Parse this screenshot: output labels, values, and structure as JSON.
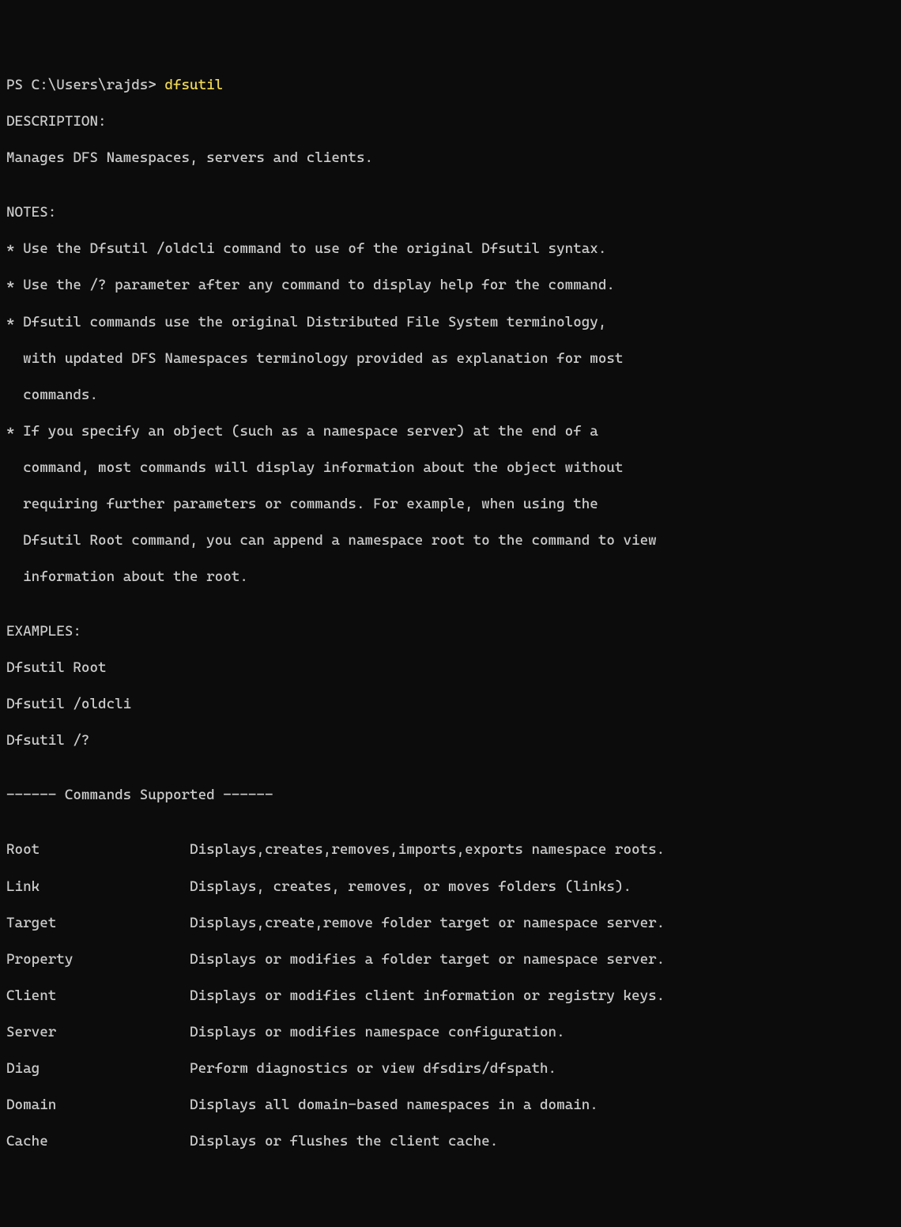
{
  "prompt": "PS C:\\Users\\rajds> ",
  "command": "dfsutil",
  "blank1": "",
  "description_header": "DESCRIPTION:",
  "description_text": "Manages DFS Namespaces, servers and clients.",
  "blank2": "",
  "notes_header": "NOTES:",
  "note1": "* Use the Dfsutil /oldcli command to use of the original Dfsutil syntax.",
  "note2": "* Use the /? parameter after any command to display help for the command.",
  "note3a": "* Dfsutil commands use the original Distributed File System terminology,",
  "note3b": "  with updated DFS Namespaces terminology provided as explanation for most",
  "note3c": "  commands.",
  "note4a": "* If you specify an object (such as a namespace server) at the end of a",
  "note4b": "  command, most commands will display information about the object without",
  "note4c": "  requiring further parameters or commands. For example, when using the",
  "note4d": "  Dfsutil Root command, you can append a namespace root to the command to view",
  "note4e": "  information about the root.",
  "blank3": "",
  "examples_header": "EXAMPLES:",
  "example1": "Dfsutil Root",
  "example2": "Dfsutil /oldcli",
  "example3": "Dfsutil /?",
  "blank4": "",
  "commands_supported": "------ Commands Supported ------",
  "blank5": "",
  "cmd_root": "Root                  Displays,creates,removes,imports,exports namespace roots.",
  "cmd_link": "Link                  Displays, creates, removes, or moves folders (links).",
  "cmd_target": "Target                Displays,create,remove folder target or namespace server.",
  "cmd_property": "Property              Displays or modifies a folder target or namespace server.",
  "cmd_client": "Client                Displays or modifies client information or registry keys.",
  "cmd_server": "Server                Displays or modifies namespace configuration.",
  "cmd_diag": "Diag                  Perform diagnostics or view dfsdirs/dfspath.",
  "cmd_domain": "Domain                Displays all domain-based namespaces in a domain.",
  "cmd_cache": "Cache                 Displays or flushes the client cache."
}
